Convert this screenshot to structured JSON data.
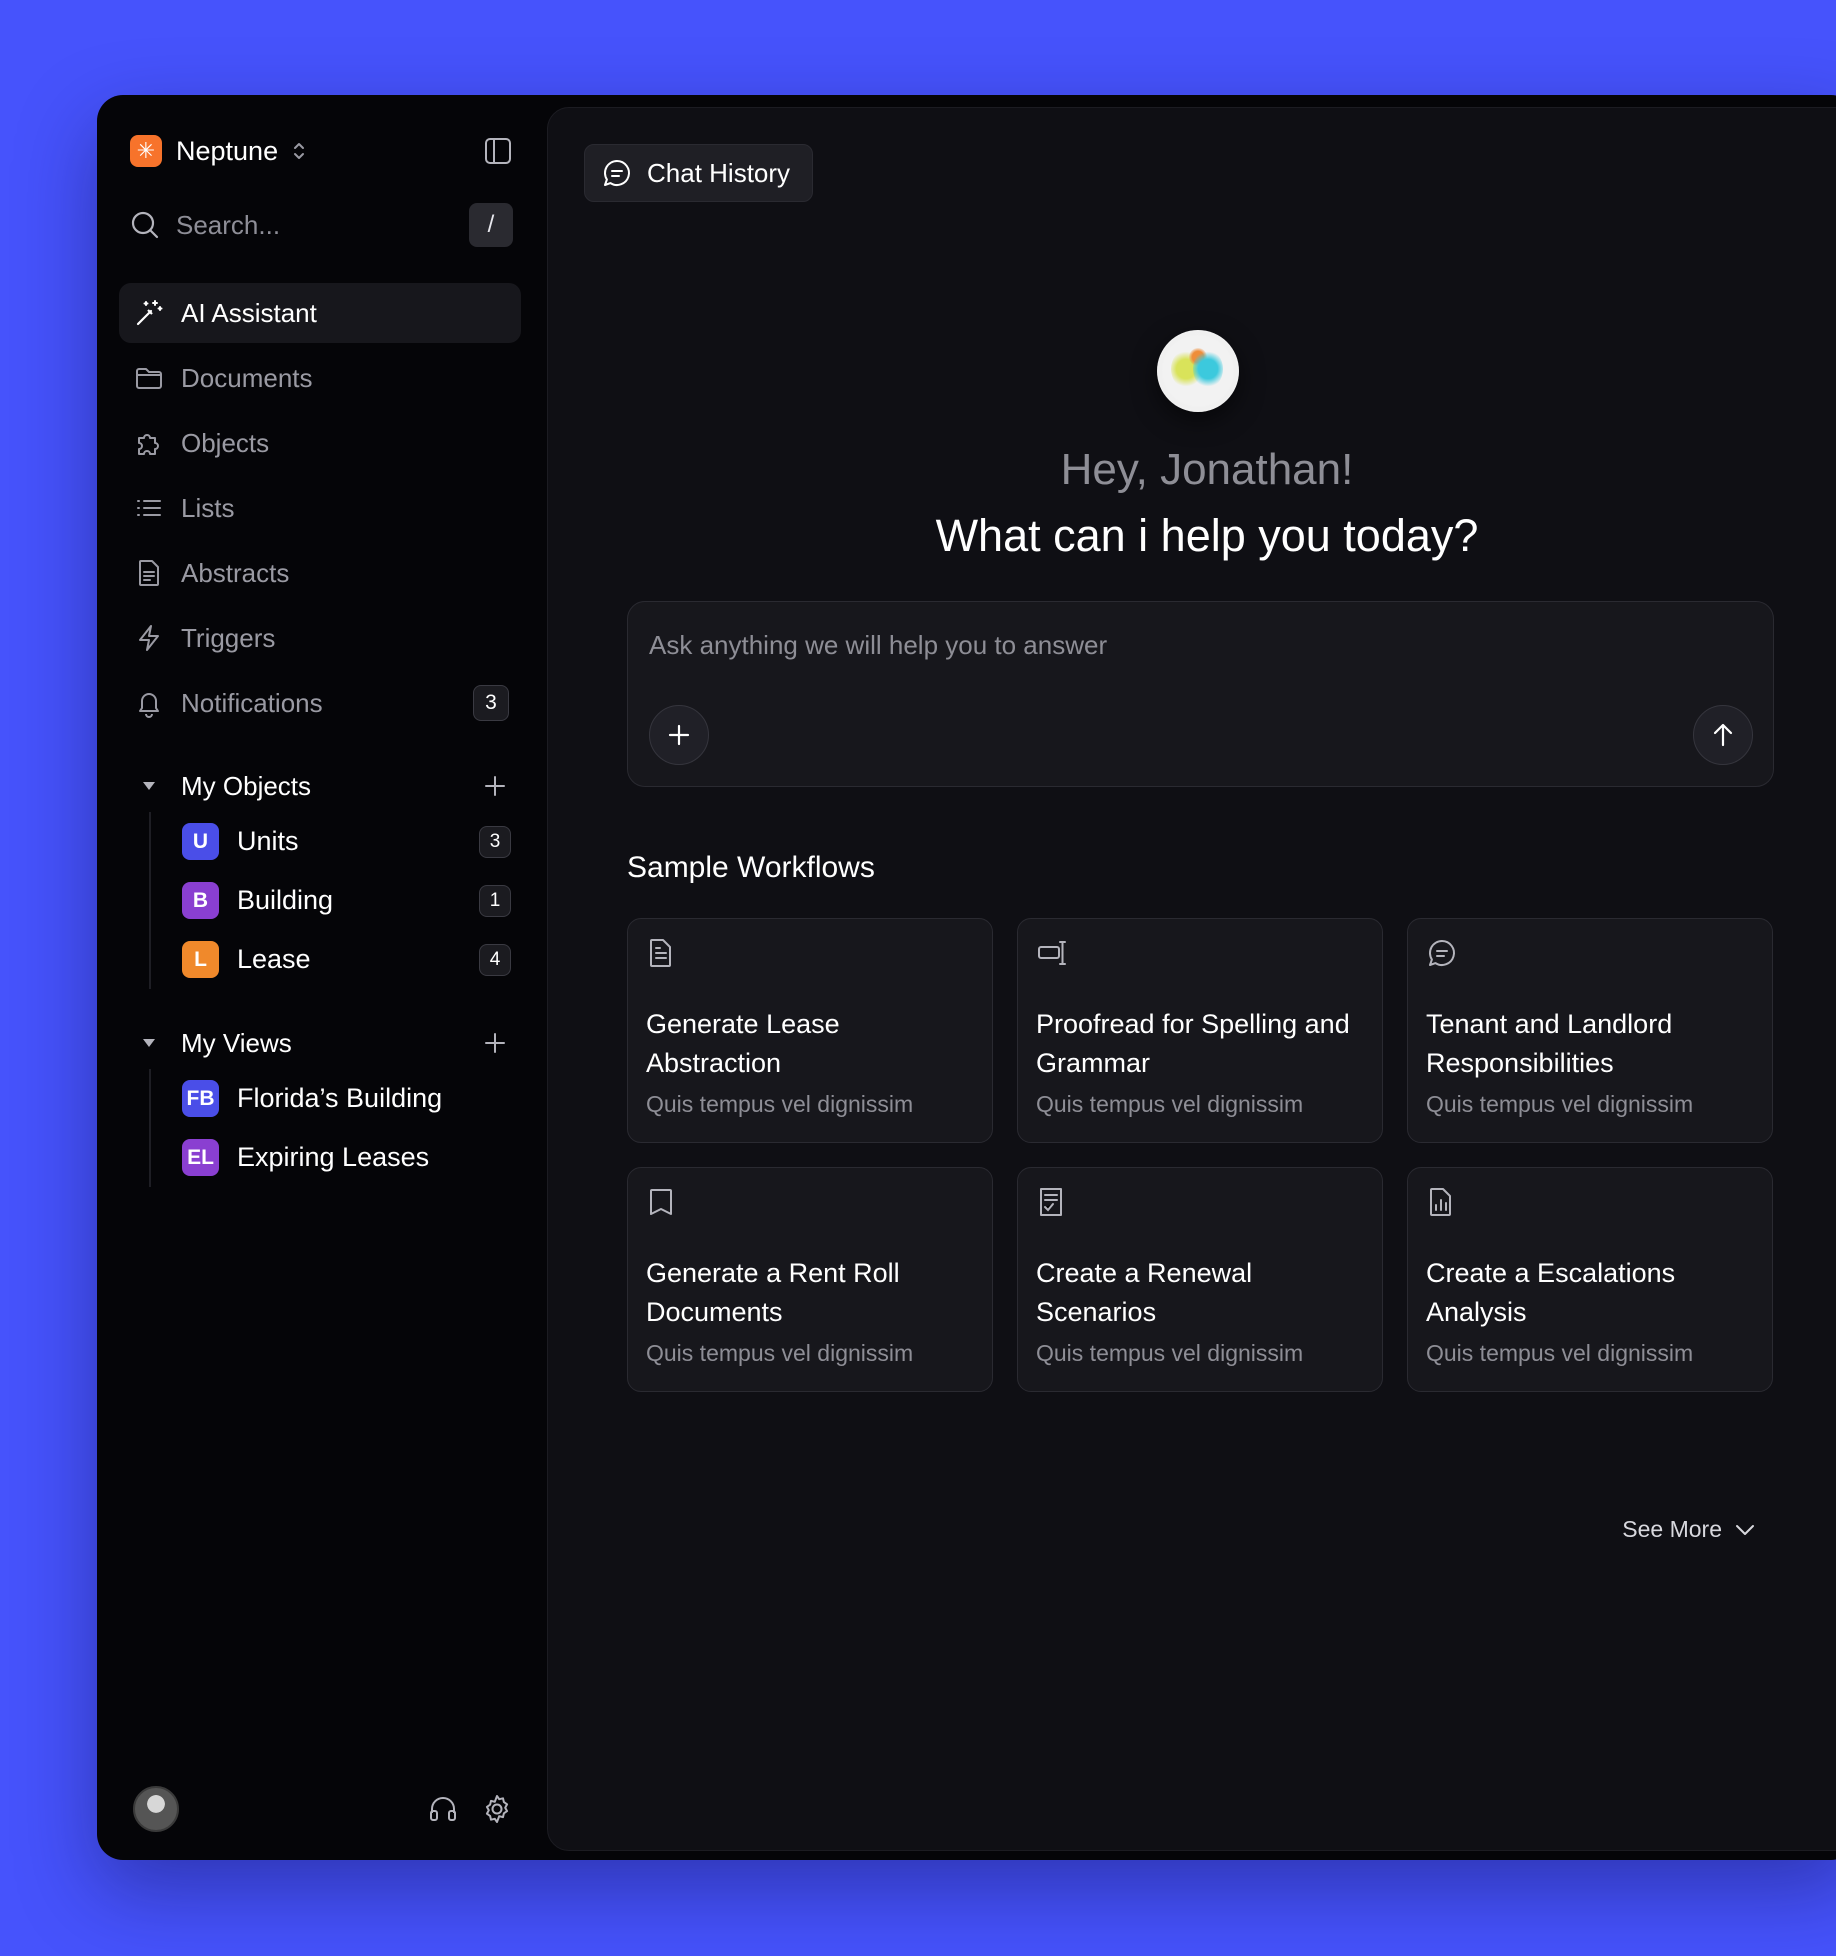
{
  "brand": {
    "name": "Neptune",
    "logo_color": "#f7732b",
    "logo_glyph": "✳"
  },
  "search": {
    "placeholder": "Search...",
    "shortcut": "/"
  },
  "nav": [
    {
      "id": "ai-assistant",
      "label": "AI Assistant",
      "icon": "magic-wand-icon",
      "active": true
    },
    {
      "id": "documents",
      "label": "Documents",
      "icon": "folder-icon"
    },
    {
      "id": "objects",
      "label": "Objects",
      "icon": "puzzle-icon"
    },
    {
      "id": "lists",
      "label": "Lists",
      "icon": "list-icon"
    },
    {
      "id": "abstracts",
      "label": "Abstracts",
      "icon": "document-icon"
    },
    {
      "id": "triggers",
      "label": "Triggers",
      "icon": "lightning-icon"
    },
    {
      "id": "notifications",
      "label": "Notifications",
      "icon": "bell-icon",
      "count": "3"
    }
  ],
  "my_objects": {
    "title": "My Objects",
    "items": [
      {
        "tag": "U",
        "label": "Units",
        "count": "3",
        "color": "#4a4ee8"
      },
      {
        "tag": "B",
        "label": "Building",
        "count": "1",
        "color": "#8a3fd1"
      },
      {
        "tag": "L",
        "label": "Lease",
        "count": "4",
        "color": "#f0892b"
      }
    ]
  },
  "my_views": {
    "title": "My Views",
    "items": [
      {
        "tag": "FB",
        "label": "Florida’s Building",
        "color": "#4a4ee8"
      },
      {
        "tag": "EL",
        "label": "Expiring Leases",
        "color": "#8a3fd1"
      }
    ]
  },
  "footer": {
    "icons": [
      "avatar",
      "headphones-icon",
      "gear-icon"
    ]
  },
  "main": {
    "chat_history_label": "Chat History",
    "greeting": "Hey, Jonathan!",
    "headline": "What can i help you today?",
    "composer_placeholder": "Ask anything we will help you to answer",
    "workflows_title": "Sample Workflows",
    "see_more_label": "See More",
    "workflows": [
      {
        "icon": "document-icon",
        "title": "Generate Lease Abstraction",
        "desc": "Quis tempus vel dignissim"
      },
      {
        "icon": "text-cursor-icon",
        "title": "Proofread for Spelling and Grammar",
        "desc": "Quis tempus vel dignissim"
      },
      {
        "icon": "chat-bubble-icon",
        "title": "Tenant and Landlord Responsibilities",
        "desc": "Quis tempus vel dignissim"
      },
      {
        "icon": "bookmark-icon",
        "title": "Generate a Rent Roll Documents",
        "desc": "Quis tempus vel dignissim"
      },
      {
        "icon": "checklist-icon",
        "title": "Create a Renewal Scenarios",
        "desc": "Quis tempus vel dignissim"
      },
      {
        "icon": "file-chart-icon",
        "title": "Create a Escalations Analysis",
        "desc": "Quis tempus vel dignissim"
      }
    ]
  },
  "colors": {
    "background": "#4653fc",
    "window": "#050508",
    "panel": "#0f0f14",
    "card": "#17171c"
  }
}
